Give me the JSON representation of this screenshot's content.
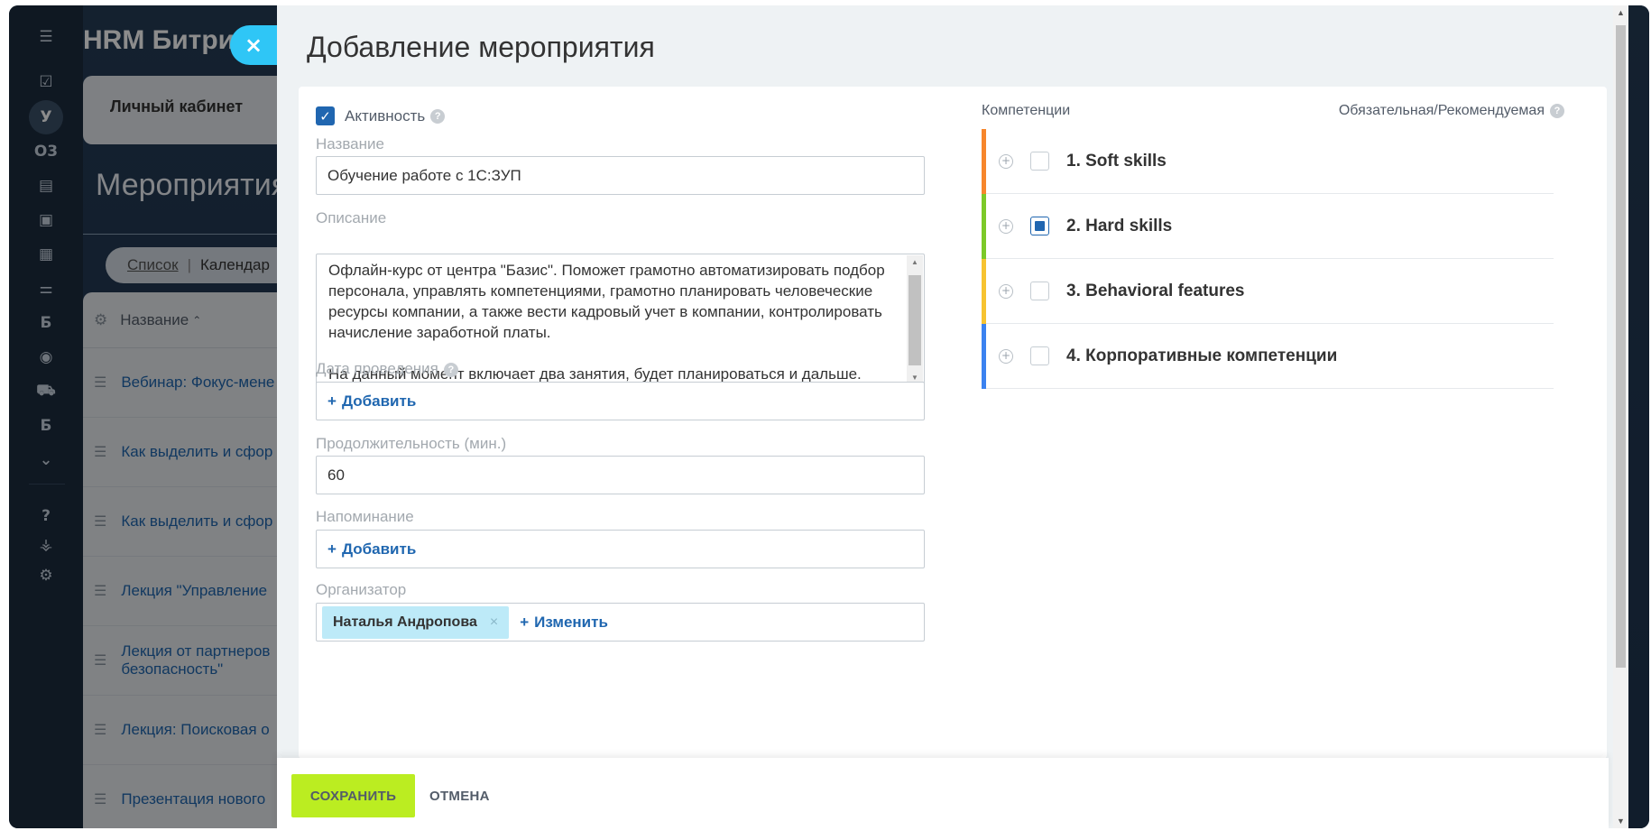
{
  "app": {
    "brand": "HRM Битри",
    "cabinet": "Личный кабинет",
    "section_title": "Мероприятия",
    "view_toggle": {
      "active": "Список",
      "other": "Календар"
    },
    "grid_header": "Название",
    "grid_rows": [
      "Вебинар: Фокус-мене",
      "Как выделить и сфор",
      "Как выделить и сфор",
      "Лекция \"Управление",
      "Лекция от партнеров безопасность\"",
      "Лекция: Поисковая о",
      "Презентация нового"
    ]
  },
  "rail": {
    "items": [
      {
        "icon": "menu-icon",
        "glyph": "☰"
      },
      {
        "icon": "tasks-icon",
        "glyph": "☑"
      },
      {
        "icon": "avatar-u",
        "glyph": "У"
      },
      {
        "icon": "o3-label",
        "glyph": "О3"
      },
      {
        "icon": "document-icon",
        "glyph": "▤"
      },
      {
        "icon": "card-icon",
        "glyph": "▣"
      },
      {
        "icon": "calendar-icon",
        "glyph": "▦"
      },
      {
        "icon": "sliders-icon",
        "glyph": "⚌"
      },
      {
        "icon": "b-label",
        "glyph": "Б"
      },
      {
        "icon": "robot-icon",
        "glyph": "◉"
      },
      {
        "icon": "cart-icon",
        "glyph": "⛟"
      },
      {
        "icon": "b-label-2",
        "glyph": "Б"
      },
      {
        "icon": "chevron-circle-icon",
        "glyph": "⌄"
      },
      {
        "icon": "help-icon",
        "glyph": "?"
      },
      {
        "icon": "structure-icon",
        "glyph": "⚶"
      },
      {
        "icon": "settings-icon",
        "glyph": "⚙"
      }
    ]
  },
  "dialog": {
    "title": "Добавление мероприятия",
    "close_glyph": "×",
    "activity_label": "Активность",
    "name_label": "Название",
    "name_value": "Обучение работе с 1С:ЗУП",
    "description_label": "Описание",
    "description_value": "Офлайн-курс от центра \"Базис\". Поможет грамотно автоматизировать подбор персонала, управлять компетенциями, грамотно планировать человеческие ресурсы компании, а также вести кадровый учет в компании, контролировать начисление заработной платы.\n\nНа данный момент включает два занятия, будет планироваться и дальше.",
    "date_label": "Дата проведения",
    "date_add": "Добавить",
    "duration_label": "Продолжительность (мин.)",
    "duration_value": "60",
    "reminder_label": "Напоминание",
    "reminder_add": "Добавить",
    "organizer_label": "Организатор",
    "organizer_name": "Наталья Андропова",
    "organizer_change": "Изменить"
  },
  "competencies": {
    "header_left": "Компетенции",
    "header_right": "Обязательная/Рекомендуемая",
    "items": [
      {
        "name": "1. Soft skills",
        "color": "#f7862c",
        "checked": false
      },
      {
        "name": "2. Hard skills",
        "color": "#7cc928",
        "checked": true
      },
      {
        "name": "3. Behavioral features",
        "color": "#f7c331",
        "checked": false
      },
      {
        "name": "4. Корпоративные компетенции",
        "color": "#3b82f0",
        "checked": false
      }
    ]
  },
  "footer": {
    "save_label": "СОХРАНИТЬ",
    "cancel_label": "ОТМЕНА"
  },
  "colors": {
    "accent_blue": "#2066b0",
    "save_green": "#bbed21",
    "close_blue": "#2fc6f6"
  }
}
